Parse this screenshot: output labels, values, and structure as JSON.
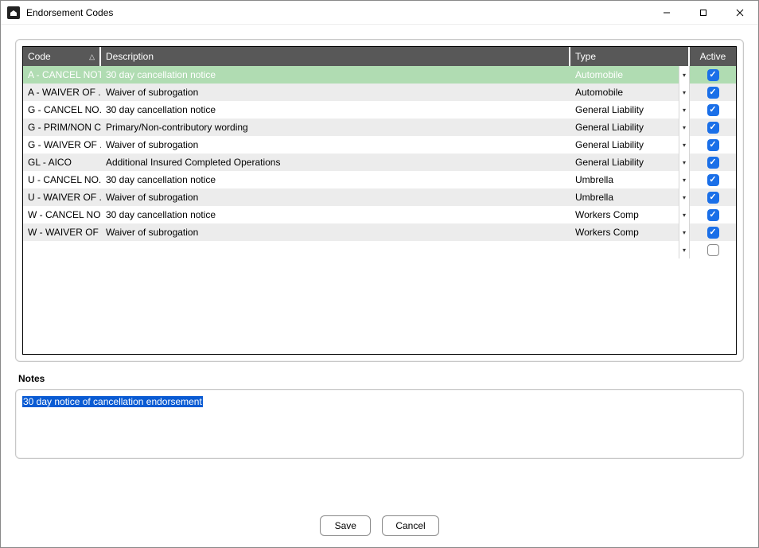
{
  "window": {
    "title": "Endorsement Codes"
  },
  "grid": {
    "headers": {
      "code": "Code",
      "description": "Description",
      "type": "Type",
      "active": "Active"
    },
    "sort_column": "code",
    "rows": [
      {
        "code": "A - CANCEL NOT...",
        "description": "30 day cancellation notice",
        "type": "Automobile",
        "active": true,
        "selected": true
      },
      {
        "code": "A - WAIVER OF ...",
        "description": "Waiver of subrogation",
        "type": "Automobile",
        "active": true
      },
      {
        "code": "G - CANCEL NO...",
        "description": "30 day cancellation notice",
        "type": "General Liability",
        "active": true
      },
      {
        "code": "G - PRIM/NON C...",
        "description": "Primary/Non-contributory wording",
        "type": "General Liability",
        "active": true
      },
      {
        "code": "G - WAIVER OF ...",
        "description": "Waiver of subrogation",
        "type": "General Liability",
        "active": true
      },
      {
        "code": "GL - AICO",
        "description": "Additional Insured Completed Operations",
        "type": "General Liability",
        "active": true
      },
      {
        "code": "U - CANCEL NO...",
        "description": "30 day cancellation notice",
        "type": "Umbrella",
        "active": true
      },
      {
        "code": "U - WAIVER OF ...",
        "description": "Waiver of subrogation",
        "type": "Umbrella",
        "active": true
      },
      {
        "code": "W - CANCEL NO...",
        "description": "30 day cancellation notice",
        "type": "Workers Comp",
        "active": true
      },
      {
        "code": "W - WAIVER OF ...",
        "description": "Waiver of subrogation",
        "type": "Workers Comp",
        "active": true
      },
      {
        "code": "",
        "description": "",
        "type": "",
        "active": false,
        "empty": true
      }
    ]
  },
  "notes": {
    "label": "Notes",
    "value": "30 day notice of cancellation endorsement",
    "selected": true
  },
  "buttons": {
    "save": "Save",
    "cancel": "Cancel"
  }
}
